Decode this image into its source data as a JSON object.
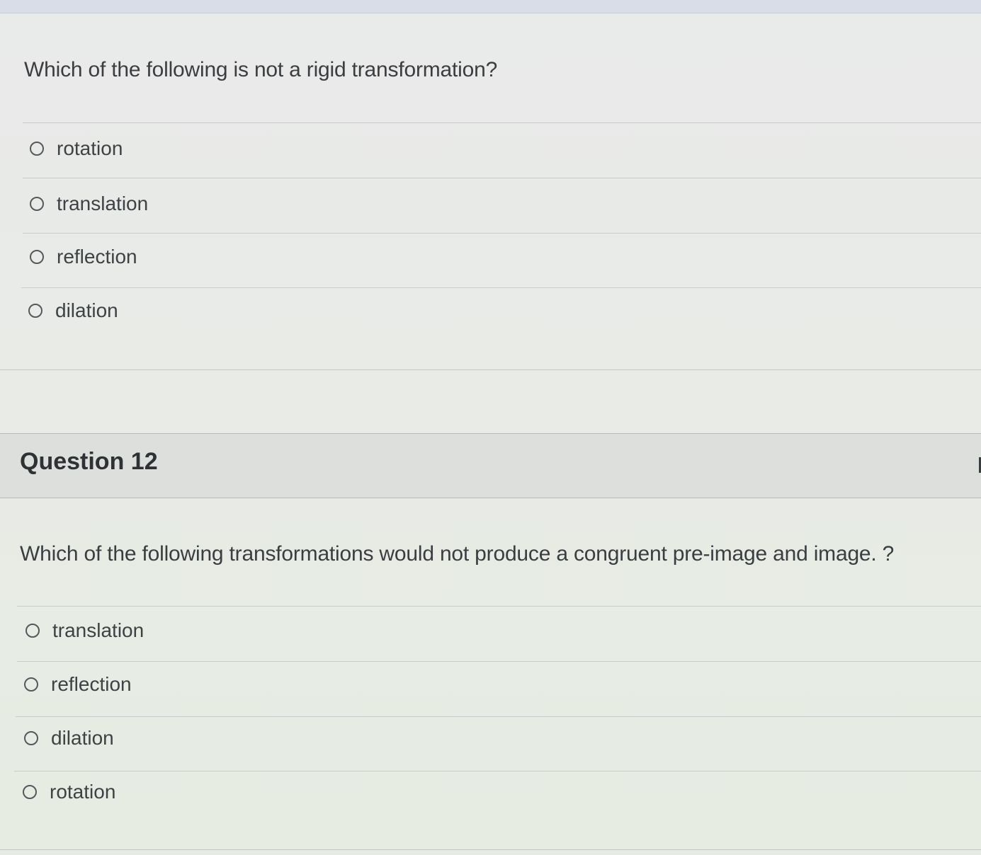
{
  "question11": {
    "prompt": "Which of the following is not a rigid transformation?",
    "answers": [
      {
        "label": "rotation"
      },
      {
        "label": "translation"
      },
      {
        "label": "reflection"
      },
      {
        "label": "dilation"
      }
    ]
  },
  "question12": {
    "title": "Question 12",
    "prompt": "Which of the following transformations would not produce a congruent pre-image and image. ?",
    "answers": [
      {
        "label": "translation"
      },
      {
        "label": "reflection"
      },
      {
        "label": "dilation"
      },
      {
        "label": "rotation"
      }
    ]
  }
}
